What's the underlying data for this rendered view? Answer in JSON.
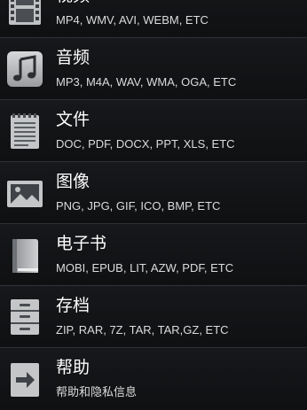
{
  "items": [
    {
      "title": "视频",
      "subtitle": "MP4, WMV, AVI, WEBM, ETC",
      "icon": "film-icon"
    },
    {
      "title": "音频",
      "subtitle": "MP3, M4A, WAV, WMA, OGA, ETC",
      "icon": "music-note-icon"
    },
    {
      "title": "文件",
      "subtitle": "DOC, PDF, DOCX, PPT, XLS, ETC",
      "icon": "document-icon"
    },
    {
      "title": "图像",
      "subtitle": "PNG, JPG, GIF, ICO, BMP, ETC",
      "icon": "image-icon"
    },
    {
      "title": "电子书",
      "subtitle": "MOBI, EPUB, LIT, AZW, PDF, ETC",
      "icon": "book-icon"
    },
    {
      "title": "存档",
      "subtitle": "ZIP, RAR, 7Z, TAR, TAR,GZ, ETC",
      "icon": "cabinet-icon"
    },
    {
      "title": "帮助",
      "subtitle": "帮助和隐私信息",
      "icon": "help-arrow-icon"
    }
  ]
}
